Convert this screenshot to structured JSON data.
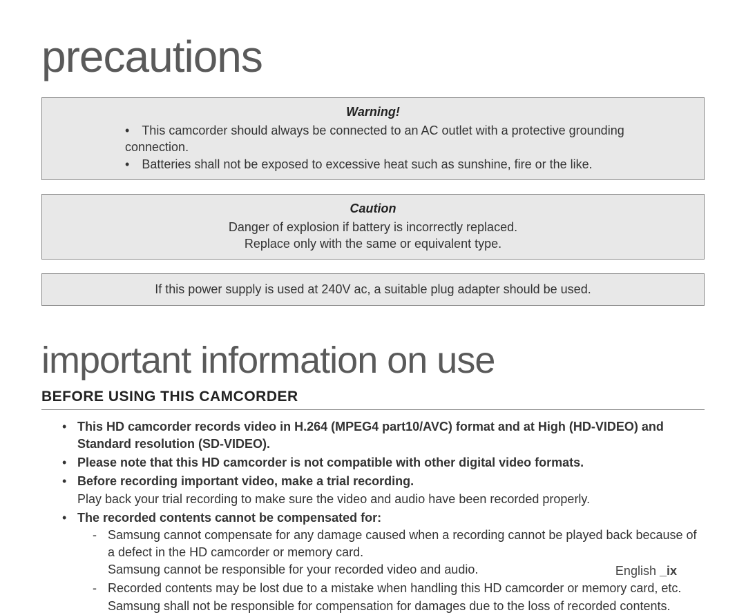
{
  "headings": {
    "precautions": "precautions",
    "important_info": "important information on use",
    "before_using": "BEFORE USING THIS CAMCORDER"
  },
  "warning_box": {
    "title": "Warning!",
    "line1": "This camcorder should always be connected to an AC outlet with a protective grounding connection.",
    "line2": "Batteries shall not be exposed to excessive heat such as sunshine, fire or the like."
  },
  "caution_box": {
    "title": "Caution",
    "line1": "Danger of explosion if battery is incorrectly replaced.",
    "line2": "Replace only with the same or equivalent type."
  },
  "voltage_box": {
    "text": "If this power supply is used at 240V ac, a suitable plug adapter should be used."
  },
  "bullets": {
    "b1": "This HD camcorder records video in H.264 (MPEG4 part10/AVC) format and at High (HD-VIDEO) and Standard resolution (SD-VIDEO).",
    "b2": "Please note that this HD camcorder is not compatible with other digital video formats.",
    "b3": "Before recording important video, make a trial recording.",
    "b3_sub": "Play back your trial recording to make sure the video and audio have been recorded properly.",
    "b4": "The recorded contents cannot be compensated for:",
    "b4_s1a": "Samsung cannot compensate for any damage caused when a recording cannot be played back because of a defect in the HD camcorder or memory card.",
    "b4_s1b": "Samsung cannot be responsible for your recorded video and audio.",
    "b4_s2": "Recorded contents may be lost due to a mistake when handling this HD camcorder or memory card, etc. Samsung shall not be responsible for compensation for damages due to the loss of recorded contents."
  },
  "footer": {
    "lang": "English ",
    "page": "_ix"
  }
}
